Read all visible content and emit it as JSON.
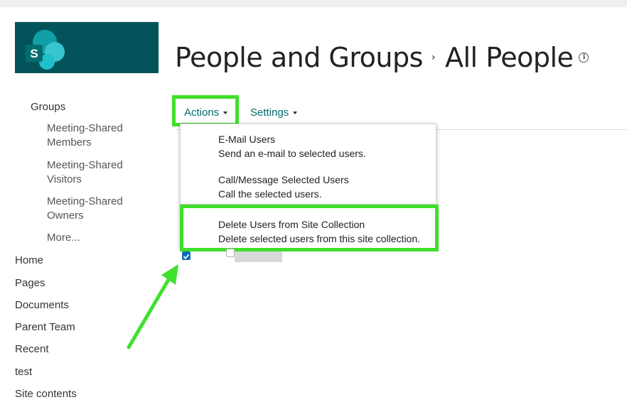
{
  "page": {
    "title_part1": "People and Groups",
    "title_separator": "›",
    "title_part2": "All People",
    "info_icon": "info-icon"
  },
  "logo": {
    "icon": "sharepoint-logo-icon",
    "letter": "S",
    "bg_color": "#03545a"
  },
  "nav": {
    "groups_label": "Groups",
    "groups": [
      "Meeting-Shared Members",
      "Meeting-Shared Visitors",
      "Meeting-Shared Owners",
      "More..."
    ],
    "links": [
      "Home",
      "Pages",
      "Documents",
      "Parent Team",
      "Recent",
      "test",
      "Site contents"
    ]
  },
  "toolbar": {
    "actions_label": "Actions",
    "settings_label": "Settings"
  },
  "actions_menu": {
    "items": [
      {
        "title": "E-Mail Users",
        "description": "Send an e-mail to selected users."
      },
      {
        "title": "Call/Message Selected Users",
        "description": "Call the selected users."
      },
      {
        "title": "Delete Users from Site Collection",
        "description": "Delete selected users from this site collection."
      }
    ]
  },
  "list": {
    "row_checked": true,
    "select_all_checked": false
  },
  "colors": {
    "highlight": "#3fe02a",
    "accent": "#036c70",
    "checkbox": "#0f6cbd"
  }
}
